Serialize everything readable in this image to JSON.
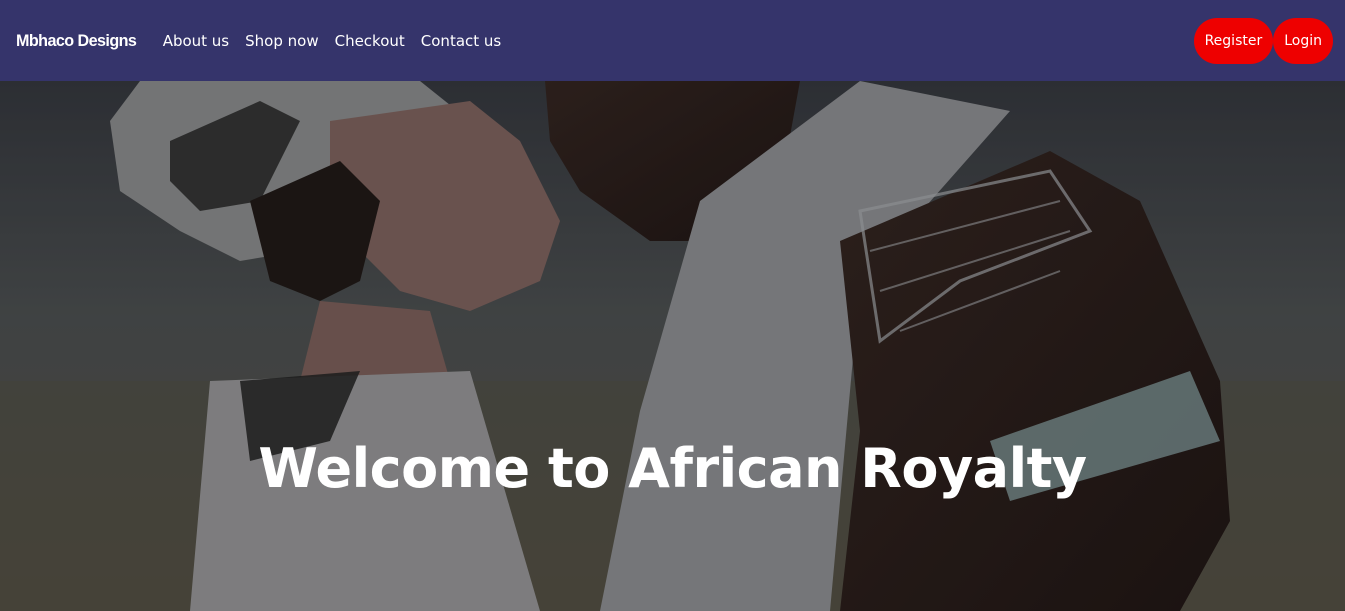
{
  "nav": {
    "brand": "Mbhaco Designs",
    "links": [
      "About us",
      "Shop now",
      "Checkout",
      "Contact us"
    ],
    "register_label": "Register",
    "login_label": "Login"
  },
  "hero": {
    "title": "Welcome to African Royalty"
  },
  "colors": {
    "navbar_bg": "#35346b",
    "button_bg": "#ee0000",
    "text": "#ffffff"
  }
}
